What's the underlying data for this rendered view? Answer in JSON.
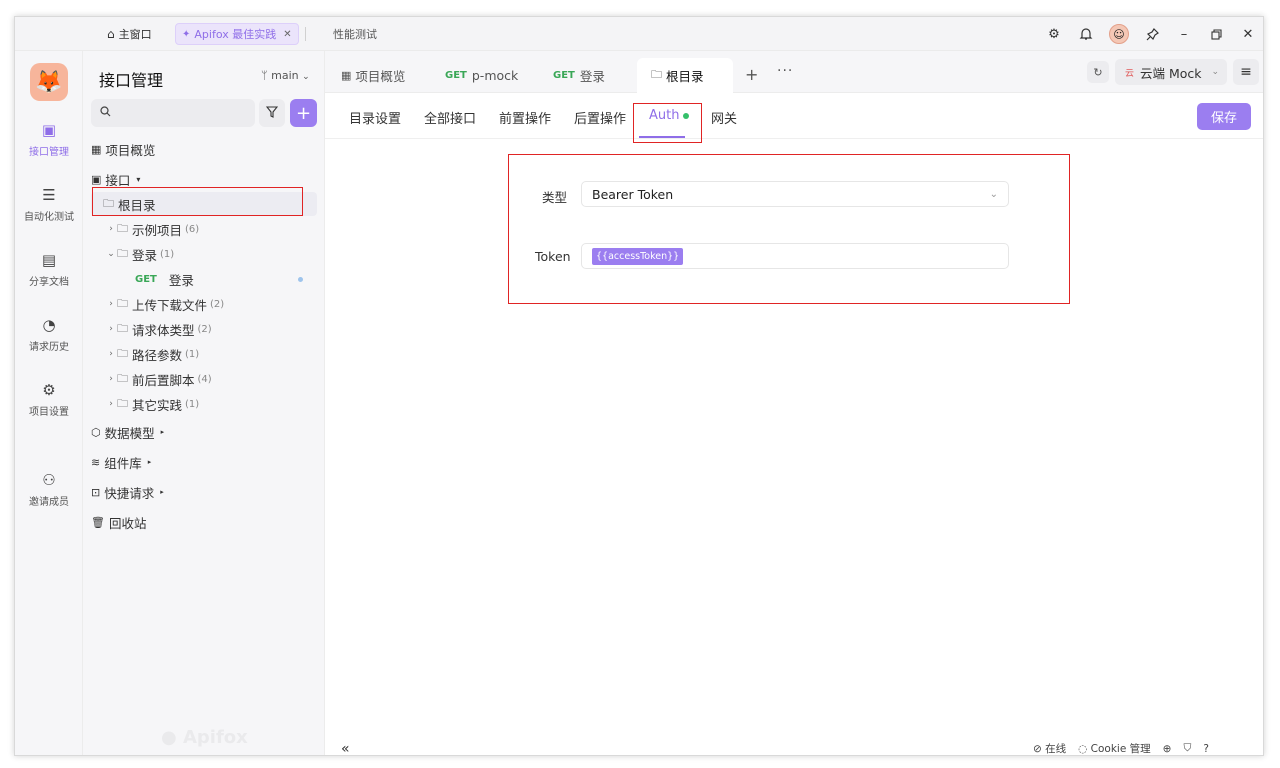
{
  "titlebar": {
    "home_tab": "主窗口",
    "active_tab": "Apifox 最佳实践",
    "perf_tab": "性能测试"
  },
  "rail": {
    "items": [
      {
        "label": "接口管理",
        "icon": "api-icon"
      },
      {
        "label": "自动化测试",
        "icon": "automation-icon"
      },
      {
        "label": "分享文档",
        "icon": "doc-icon"
      },
      {
        "label": "请求历史",
        "icon": "history-icon"
      },
      {
        "label": "项目设置",
        "icon": "settings-icon"
      },
      {
        "label": "邀请成员",
        "icon": "invite-icon"
      }
    ]
  },
  "sidebar": {
    "title": "接口管理",
    "branch": "main",
    "items": {
      "overview": "项目概览",
      "api": "接口",
      "root": "根目录",
      "f1": {
        "label": "示例项目",
        "count": "(6)"
      },
      "f2": {
        "label": "登录",
        "count": "(1)"
      },
      "f2_req": {
        "method": "GET",
        "label": "登录"
      },
      "f3": {
        "label": "上传下载文件",
        "count": "(2)"
      },
      "f4": {
        "label": "请求体类型",
        "count": "(2)"
      },
      "f5": {
        "label": "路径参数",
        "count": "(1)"
      },
      "f6": {
        "label": "前后置脚本",
        "count": "(4)"
      },
      "f7": {
        "label": "其它实践",
        "count": "(1)"
      },
      "models": "数据模型",
      "components": "组件库",
      "quick": "快捷请求",
      "trash": "回收站"
    },
    "watermark": "Apifox"
  },
  "tabs": {
    "t1": "项目概览",
    "t2_method": "GET",
    "t2": "p-mock",
    "t3_method": "GET",
    "t3": "登录",
    "t4": "根目录",
    "add": "+",
    "more": "···"
  },
  "env": {
    "tag": "云",
    "label": "云端 Mock"
  },
  "subtabs": {
    "s1": "目录设置",
    "s2": "全部接口",
    "s3": "前置操作",
    "s4": "后置操作",
    "s5": "Auth",
    "s6": "网关"
  },
  "save_label": "保存",
  "auth": {
    "type_label": "类型",
    "type_value": "Bearer Token",
    "token_label": "Token",
    "token_value": "{{accessToken}}"
  },
  "status": {
    "online": "在线",
    "cookie": "Cookie 管理"
  },
  "colors": {
    "accent": "#9b7ef0",
    "highlight": "#e02424",
    "method_get": "#3aa757"
  }
}
